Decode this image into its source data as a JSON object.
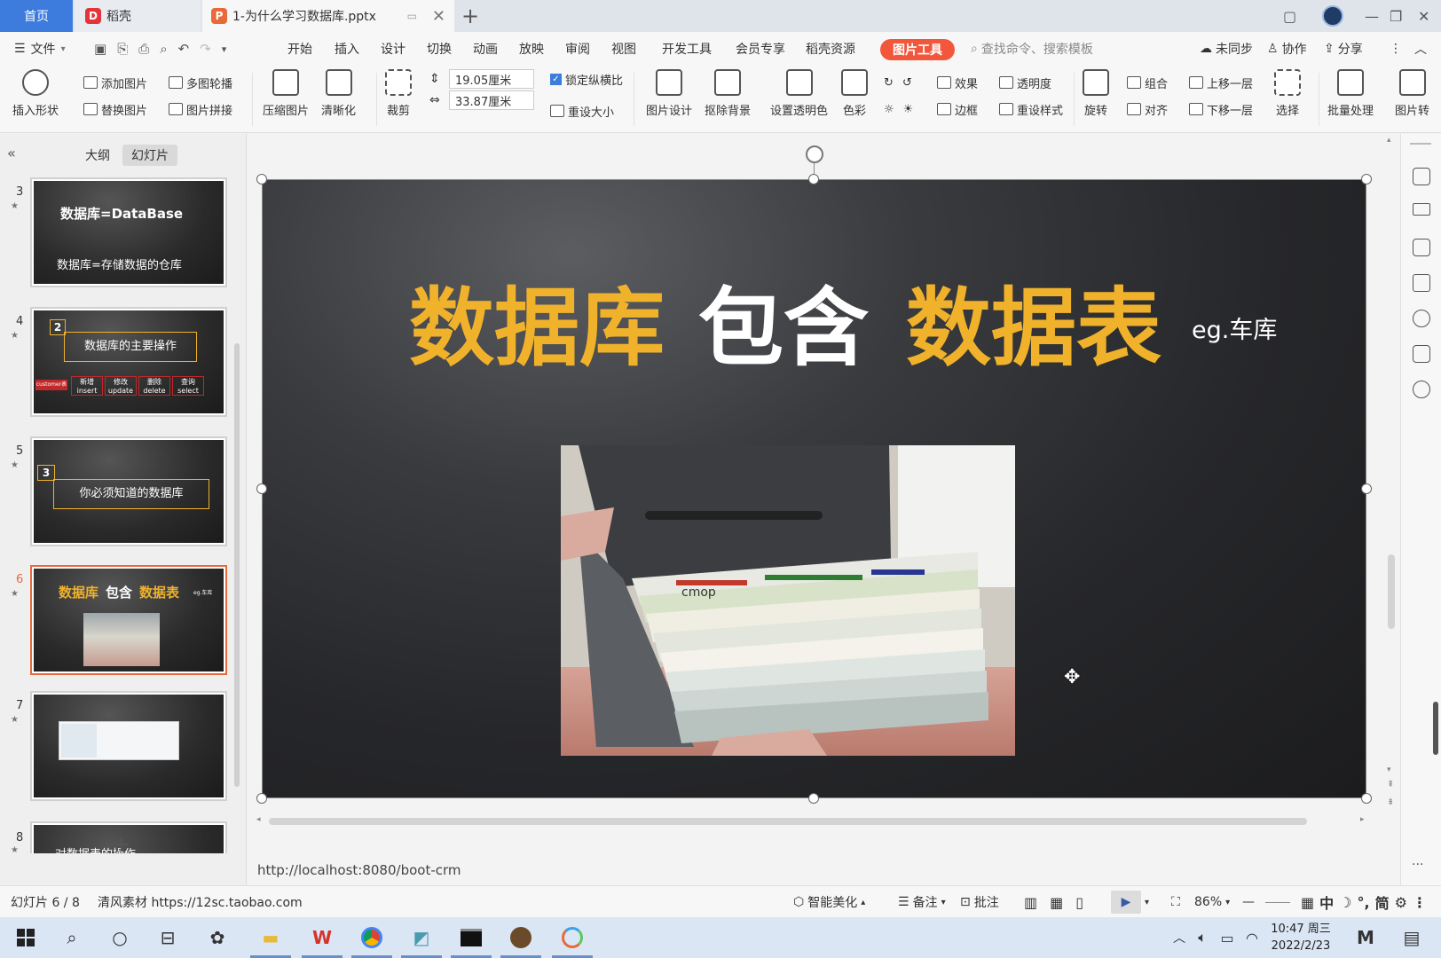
{
  "tabs": {
    "home": "首页",
    "daoke": "稻壳",
    "doc": "1-为什么学习数据库.pptx"
  },
  "menu": {
    "file": "文件",
    "items": [
      "开始",
      "插入",
      "设计",
      "切换",
      "动画",
      "放映",
      "审阅",
      "视图",
      "开发工具",
      "会员专享",
      "稻壳资源"
    ],
    "picture_tools": "图片工具",
    "search_placeholder": "查找命令、搜索模板",
    "unsynced": "未同步",
    "collaborate": "协作",
    "share": "分享"
  },
  "ribbon": {
    "insert_shape": "插入形状",
    "add_image": "添加图片",
    "replace_image": "替换图片",
    "multi_carousel": "多图轮播",
    "image_splice": "图片拼接",
    "compress_image": "压缩图片",
    "sharpen": "清晰化",
    "crop": "裁剪",
    "height_value": "19.05厘米",
    "width_value": "33.87厘米",
    "lock_aspect": "锁定纵横比",
    "reset_size": "重设大小",
    "image_design": "图片设计",
    "remove_bg": "抠除背景",
    "set_transparent": "设置透明色",
    "color": "色彩",
    "effect": "效果",
    "border": "边框",
    "transparency": "透明度",
    "reset_style": "重设样式",
    "rotate": "旋转",
    "group": "组合",
    "align": "对齐",
    "bring_forward": "上移一层",
    "send_backward": "下移一层",
    "select": "选择",
    "batch": "批量处理",
    "image_more": "图片转"
  },
  "left_panel": {
    "tab_outline": "大纲",
    "tab_slides": "幻灯片",
    "thumbnails": [
      {
        "num": "3",
        "title": "数据库=DataBase",
        "sub": "数据库=存储数据的仓库"
      },
      {
        "num": "4",
        "badge": "2",
        "title": "数据库的主要操作",
        "ops": [
          "新增 insert",
          "修改 update",
          "删除 delete",
          "查询 select"
        ],
        "tag": "customer表"
      },
      {
        "num": "5",
        "badge": "3",
        "title": "你必须知道的数据库"
      },
      {
        "num": "6",
        "title_parts": [
          "数据库",
          "包含",
          "数据表"
        ],
        "note": "eg.车库"
      },
      {
        "num": "7"
      },
      {
        "num": "8",
        "title": "对数据表的操作"
      }
    ]
  },
  "slide": {
    "word1": "数据库",
    "word2": "包含",
    "word3": "数据表",
    "note": "eg.车库",
    "photo_label": "cmop",
    "colors": {
      "accent": "#f1b22b",
      "white": "#ffffff",
      "bg": "#26272a"
    }
  },
  "url": "http://localhost:8080/boot-crm",
  "status": {
    "slide_counter": "幻灯片 6 / 8",
    "source": "清风素材 https://12sc.taobao.com",
    "smart_beautify": "智能美化",
    "notes": "备注",
    "comment": "批注",
    "zoom": "86%",
    "ime": "中",
    "ime2": "简"
  },
  "taskbar": {
    "time": "10:47 周三",
    "date": "2022/2/23"
  }
}
